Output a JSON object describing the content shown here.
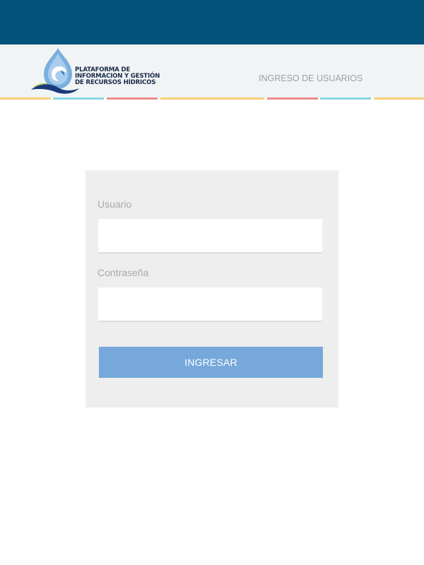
{
  "header": {
    "logo_lines": [
      "PLATAFORMA DE",
      "INFORMACION Y GESTIÓN",
      "DE RECURSOS HÍDRICOS"
    ],
    "nav_link": "INGRESO DE USUARIOS"
  },
  "colors": {
    "topbar": "#03537b",
    "header_bg": "#f1f4f5",
    "button": "#76a8db",
    "stripe_yellow": "#f5cf7a",
    "stripe_cyan": "#86d6e0",
    "stripe_red": "#ee8c8a"
  },
  "login": {
    "username_label": "Usuario",
    "username_value": "",
    "password_label": "Contraseña",
    "password_value": "",
    "submit_label": "INGRESAR"
  }
}
